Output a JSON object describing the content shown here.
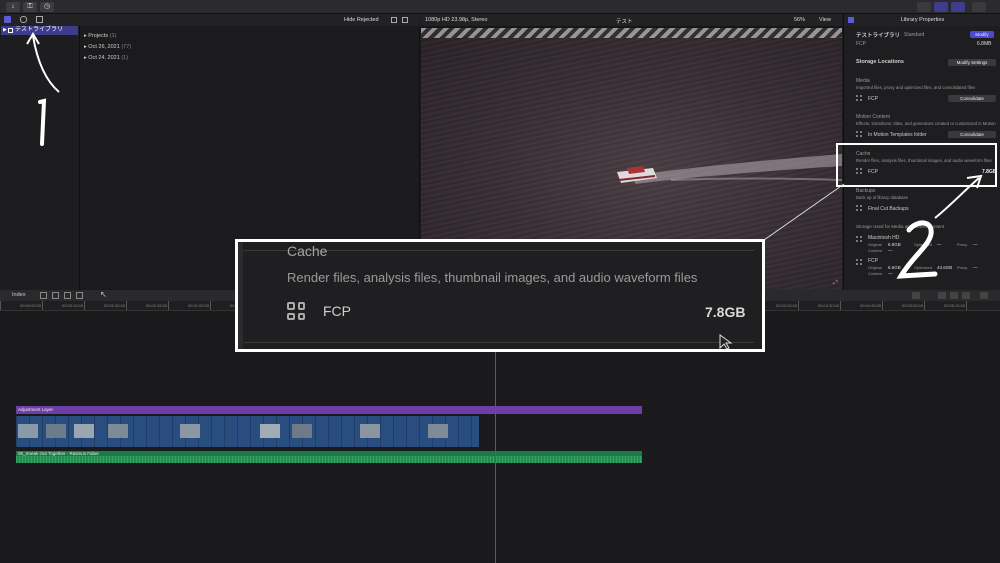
{
  "library": {
    "name": "テストライブラリ"
  },
  "browser": {
    "filter": "Hide Rejected",
    "events": [
      {
        "name": "Projects",
        "count": "(1)"
      },
      {
        "name": "Oct 26, 2021",
        "count": "(77)"
      },
      {
        "name": "Oct 24, 2021",
        "count": "(1)"
      }
    ]
  },
  "viewer": {
    "format": "1080p HD 23.98p, Stereo",
    "title": "テスト",
    "zoom": "56%",
    "view": "View"
  },
  "inspector": {
    "title": "Library Properties",
    "lib_name": "テストライブラリ",
    "lib_type": "Standard",
    "modify": "Modify",
    "lib_sub": "FCP",
    "lib_size": "6.8MB",
    "storage_locations": "Storage Locations",
    "modify_settings": "Modify Settings",
    "media_title": "Media",
    "media_desc": "Imported files, proxy and optimized files, and consolidated files",
    "media_loc": "FCP",
    "consolidate": "Consolidate",
    "motion_title": "Motion Content",
    "motion_desc": "Effects, transitions, titles, and generators created or customized in Motion",
    "motion_loc": "In Motion Templates folder",
    "consolidate2": "Consolidate",
    "cache_title": "Cache",
    "cache_desc": "Render files, analysis files, thumbnail images, and audio waveform files",
    "cache_loc": "FCP",
    "cache_size": "7.8GB",
    "backups_title": "Backups",
    "backups_desc": "Back up of library database",
    "backups_loc": "Final Cut Backups",
    "storage_used": "Storage Used for Media and Motion Content",
    "disk1": "Macintosh HD",
    "disk1_original_label": "Original",
    "disk1_original": "6.9GB",
    "disk1_optimized_label": "Optimized",
    "disk1_optimized": "—",
    "disk1_proxy_label": "Proxy",
    "disk1_proxy": "—",
    "disk1_content_label": "Content",
    "disk1_content": "—",
    "disk2": "FCP",
    "disk2_original_label": "Original",
    "disk2_original": "6.6GB",
    "disk2_optimized_label": "Optimized",
    "disk2_optimized": "43.6GB",
    "disk2_proxy_label": "Proxy",
    "disk2_proxy": "—",
    "disk2_content_label": "Content",
    "disk2_content": "—"
  },
  "timeline": {
    "index": "Index",
    "adjustment_layer": "Adjustment Layer",
    "audio_clip": "05_Sneak Out Together - Rasmus Faber",
    "timecodes": [
      "00:00:00:00",
      "00:00:15:00",
      "00:00:30:00",
      "00:00:45:00",
      "00:01:00:00",
      "00:01:15:00",
      "00:01:30:00",
      "00:01:45:00",
      "00:02:00:00",
      "00:04:15:00",
      "00:04:30:00",
      "00:04:45:00",
      "00:05:00:00",
      "00:05:15:00",
      "00:05:30:00",
      "00:05:45:00"
    ]
  },
  "zoom": {
    "title": "Cache",
    "desc": "Render files, analysis files, thumbnail images, and audio waveform files",
    "loc": "FCP",
    "size": "7.8GB"
  },
  "annotations": {
    "one": "1",
    "two": "2"
  }
}
